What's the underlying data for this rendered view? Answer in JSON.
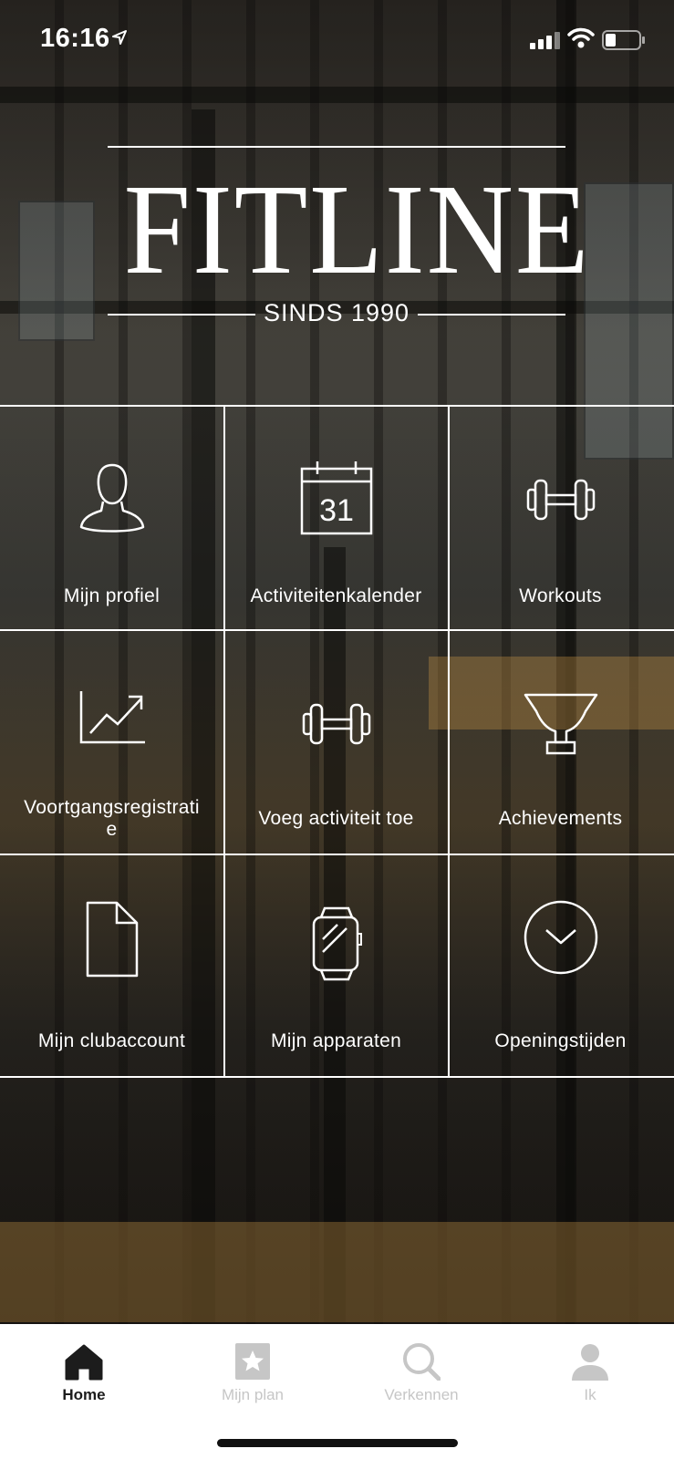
{
  "status_bar": {
    "time": "16:16"
  },
  "logo": {
    "brand": "FITLINE",
    "tagline": "SINDS 1990"
  },
  "tiles": [
    {
      "label": "Mijn profiel",
      "icon": "user-silhouette-icon"
    },
    {
      "label": "Activiteitenkalender",
      "icon": "calendar-icon",
      "icon_text": "31"
    },
    {
      "label": "Workouts",
      "icon": "dumbbell-icon"
    },
    {
      "label": "Voortgangsregistrati\ne",
      "icon": "progress-chart-icon"
    },
    {
      "label": "Voeg activiteit toe",
      "icon": "dumbbell-icon"
    },
    {
      "label": "Achievements",
      "icon": "trophy-icon"
    },
    {
      "label": "Mijn clubaccount",
      "icon": "document-icon"
    },
    {
      "label": "Mijn apparaten",
      "icon": "smartwatch-icon"
    },
    {
      "label": "Openingstijden",
      "icon": "clock-chevron-icon"
    }
  ],
  "tabbar": {
    "home": "Home",
    "plan": "Mijn plan",
    "explore": "Verkennen",
    "me": "Ik",
    "active_color": "#1c1c1c",
    "inactive_color": "#c6c6c6"
  }
}
